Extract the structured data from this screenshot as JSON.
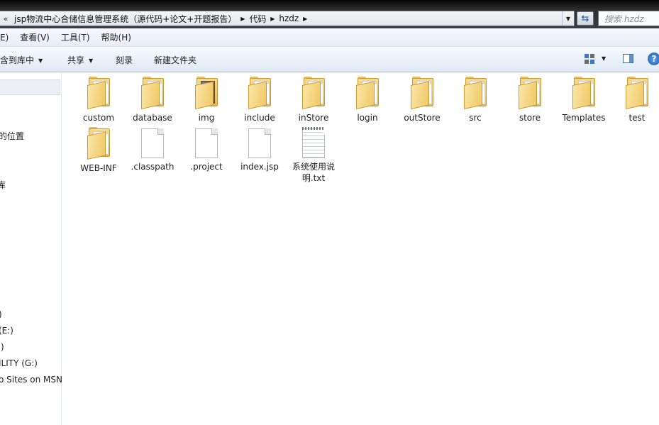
{
  "address_bar": {
    "more_glyph": "«",
    "crumbs": [
      "jsp物流中心合储信息管理系统（源代码+论文+开题报告）",
      "代码",
      "hzdz"
    ],
    "search_placeholder": "搜索 hzdz"
  },
  "menu": [
    "E)",
    "查看(V)",
    "工具(T)",
    "帮助(H)"
  ],
  "commands": {
    "include_library": "包含到库中",
    "share": "共享",
    "burn": "刻录",
    "new_folder": "新建文件夹",
    "help_glyph": "?"
  },
  "nav_pane": {
    "items": [
      "的位置",
      "库",
      ")",
      "(E:)",
      ":)",
      "ILITY (G:)",
      "o Sites on MSN"
    ]
  },
  "files": [
    {
      "name": "custom",
      "type": "folder"
    },
    {
      "name": "database",
      "type": "folder"
    },
    {
      "name": "img",
      "type": "folder-img"
    },
    {
      "name": "include",
      "type": "folder"
    },
    {
      "name": "inStore",
      "type": "folder"
    },
    {
      "name": "login",
      "type": "folder"
    },
    {
      "name": "outStore",
      "type": "folder"
    },
    {
      "name": "src",
      "type": "folder"
    },
    {
      "name": "store",
      "type": "folder"
    },
    {
      "name": "Templates",
      "type": "folder"
    },
    {
      "name": "test",
      "type": "folder"
    },
    {
      "name": "WEB-INF",
      "type": "folder"
    },
    {
      "name": ".classpath",
      "type": "file"
    },
    {
      "name": ".project",
      "type": "file"
    },
    {
      "name": "index.jsp",
      "type": "file"
    },
    {
      "name": "系统使用说明.txt",
      "type": "text"
    }
  ]
}
